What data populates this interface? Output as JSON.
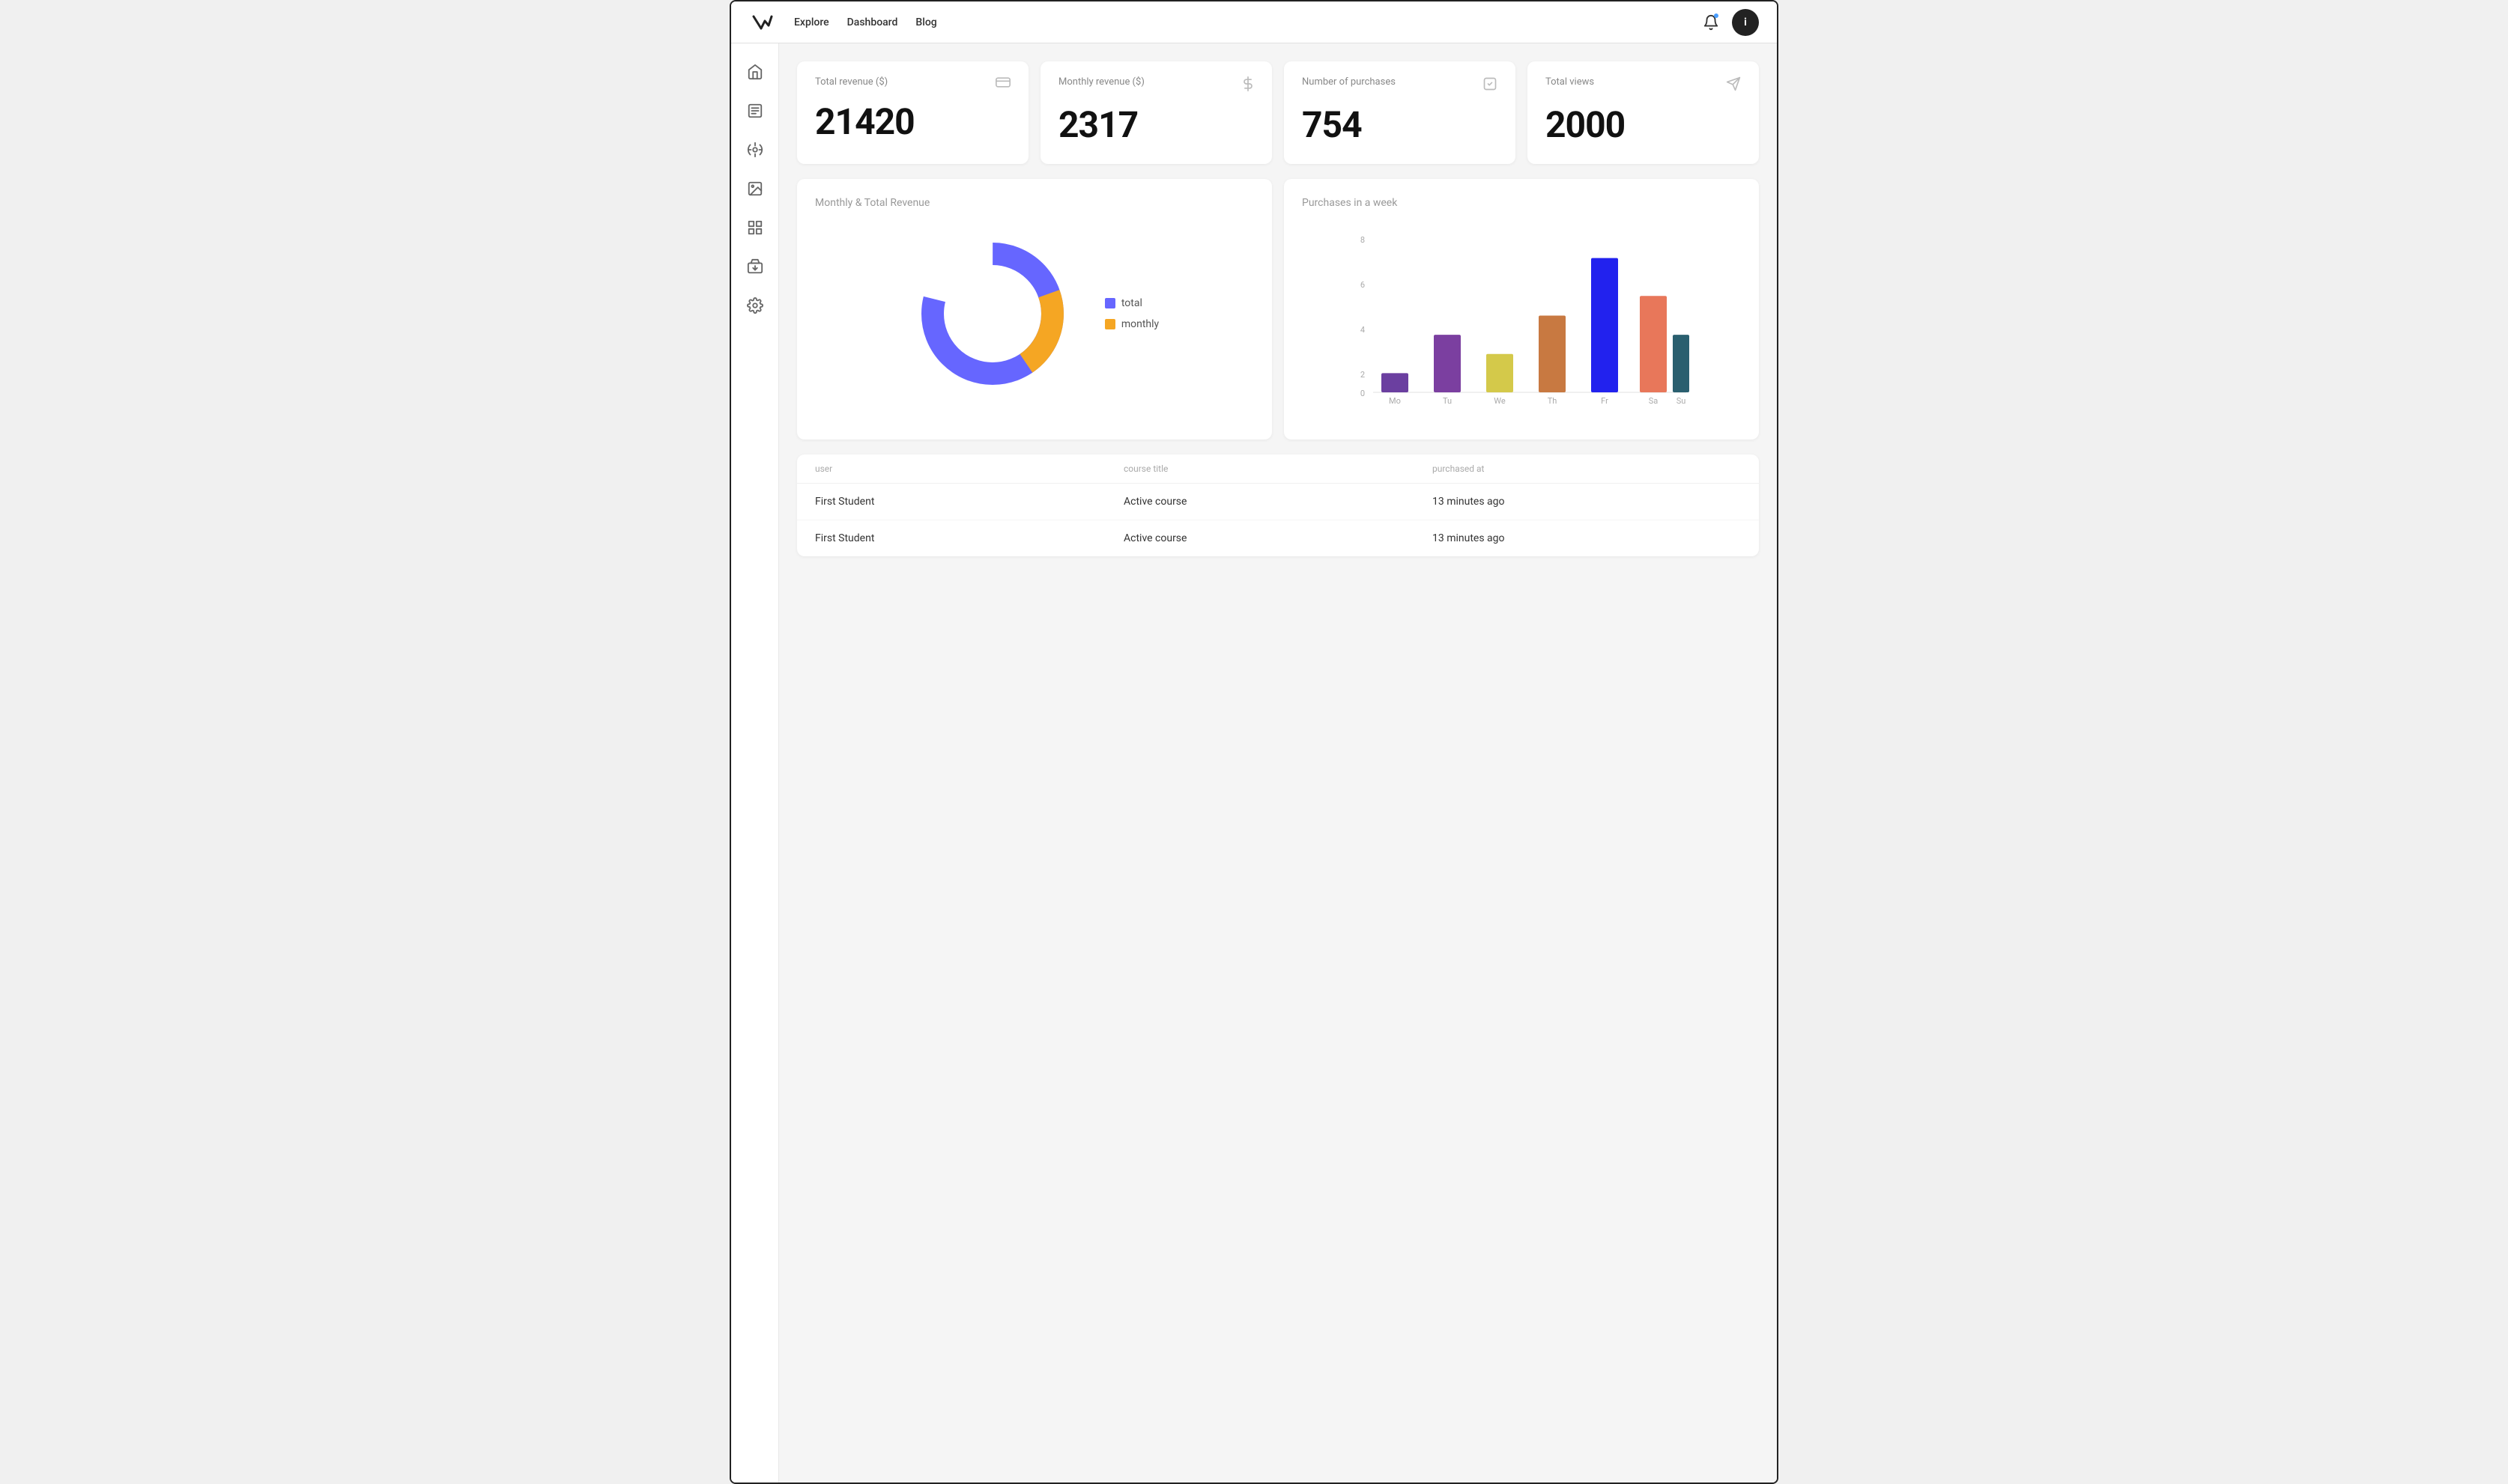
{
  "nav": {
    "links": [
      {
        "label": "Explore",
        "id": "explore"
      },
      {
        "label": "Dashboard",
        "id": "dashboard"
      },
      {
        "label": "Blog",
        "id": "blog"
      }
    ],
    "user_initial": "i"
  },
  "sidebar": {
    "items": [
      {
        "id": "home",
        "icon": "home-icon"
      },
      {
        "id": "document",
        "icon": "document-icon"
      },
      {
        "id": "tools",
        "icon": "tools-icon"
      },
      {
        "id": "image",
        "icon": "image-icon"
      },
      {
        "id": "layout",
        "icon": "layout-icon"
      },
      {
        "id": "media",
        "icon": "media-icon"
      },
      {
        "id": "settings",
        "icon": "settings-icon"
      }
    ]
  },
  "stats": [
    {
      "title": "Total revenue ($)",
      "value": "21420",
      "icon": "card-icon"
    },
    {
      "title": "Monthly revenue ($)",
      "value": "2317",
      "icon": "dollar-icon"
    },
    {
      "title": "Number of purchases",
      "value": "754",
      "icon": "check-icon"
    },
    {
      "title": "Total views",
      "value": "2000",
      "icon": "send-icon"
    }
  ],
  "donut_chart": {
    "title": "Monthly & Total Revenue",
    "legend": [
      {
        "label": "total",
        "color": "#6666ff"
      },
      {
        "label": "monthly",
        "color": "#f5a623"
      }
    ],
    "total_percent": 79,
    "monthly_percent": 21
  },
  "bar_chart": {
    "title": "Purchases in a week",
    "y_max": 8,
    "bars": [
      {
        "day": "Mo",
        "value": 1,
        "color": "#6b3fa0"
      },
      {
        "day": "Tu",
        "value": 3,
        "color": "#7b3fa0"
      },
      {
        "day": "We",
        "value": 2,
        "color": "#d4c94a"
      },
      {
        "day": "Th",
        "value": 4,
        "color": "#c87941"
      },
      {
        "day": "Fr",
        "value": 7,
        "color": "#2222ee"
      },
      {
        "day": "Sa",
        "value": 5,
        "color": "#e8775a"
      },
      {
        "day": "Su",
        "value": 3,
        "color": "#2a5f6f"
      }
    ]
  },
  "table": {
    "headers": [
      "user",
      "course title",
      "purchased at"
    ],
    "rows": [
      {
        "user": "First Student",
        "course": "Active course",
        "time": "13 minutes ago"
      },
      {
        "user": "First Student",
        "course": "Active course",
        "time": "13 minutes ago"
      }
    ]
  }
}
